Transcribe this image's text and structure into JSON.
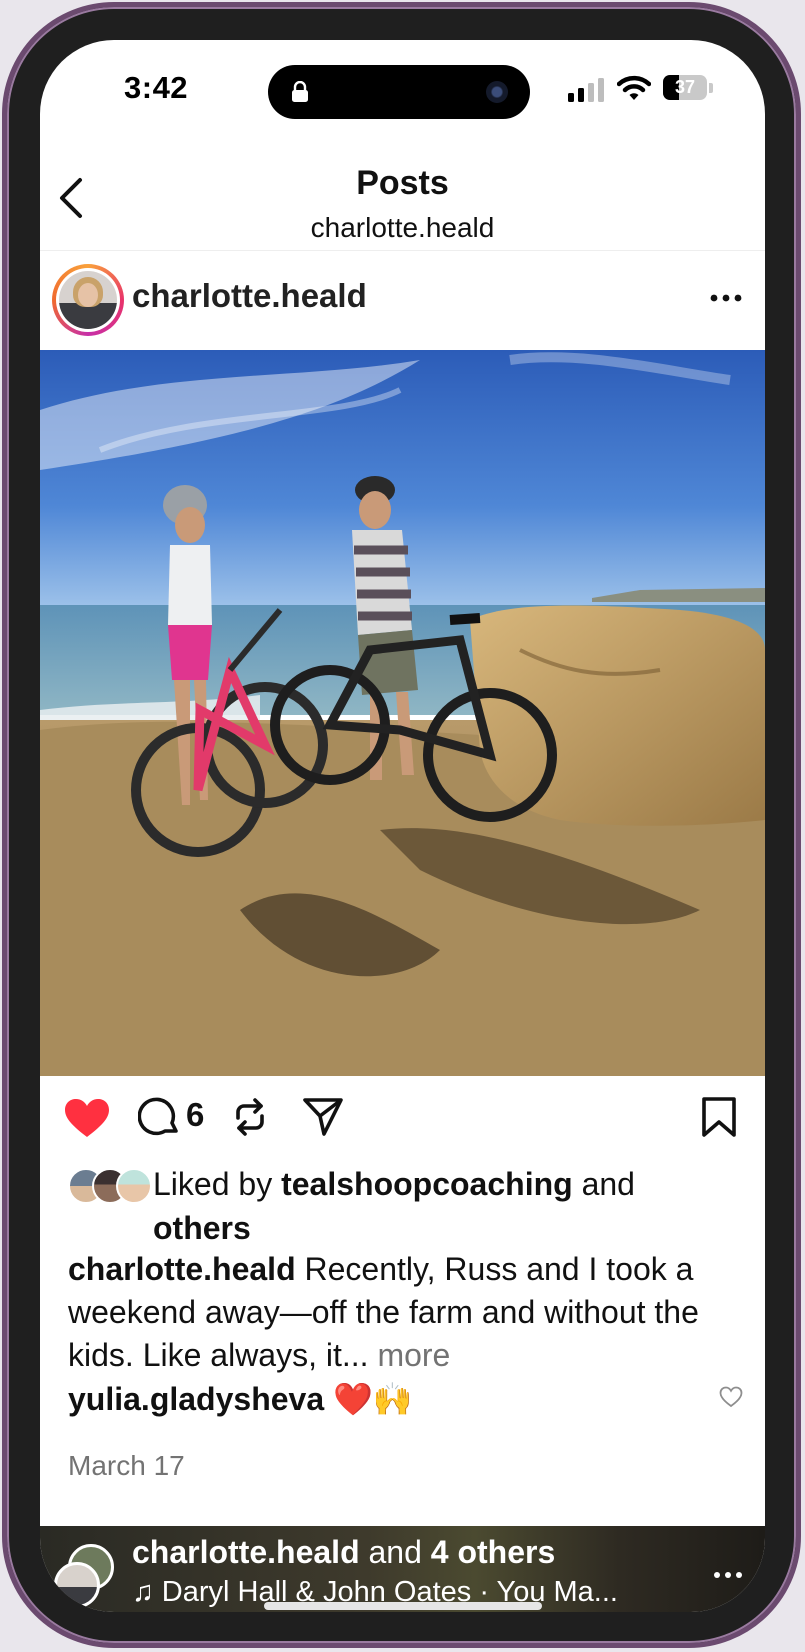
{
  "status_bar": {
    "time": "3:42",
    "battery_percent": "37",
    "battery_level": 0.37
  },
  "header": {
    "title": "Posts",
    "subtitle": "charlotte.heald"
  },
  "post": {
    "username": "charlotte.heald",
    "comment_count": "6",
    "liked": true,
    "liked_by_prefix": "Liked by ",
    "liked_by_user": "tealshoopcoaching",
    "liked_by_and": " and ",
    "liked_by_others": "others",
    "caption_user": "charlotte.heald",
    "caption_text": " Recently, Russ and I took a weekend away—off the farm and without the kids. Like always, it... ",
    "caption_more": "more",
    "top_comment_user": "yulia.gladysheva",
    "top_comment_text": " ❤️🙌",
    "date": "March 17"
  },
  "next_post": {
    "user": "charlotte.heald",
    "and_text": " and ",
    "others": "4 others",
    "music": "♫ Daryl Hall & John Oates · You Ma..."
  },
  "colors": {
    "like_red": "#ff3040",
    "text": "#111111",
    "muted": "#737373"
  }
}
